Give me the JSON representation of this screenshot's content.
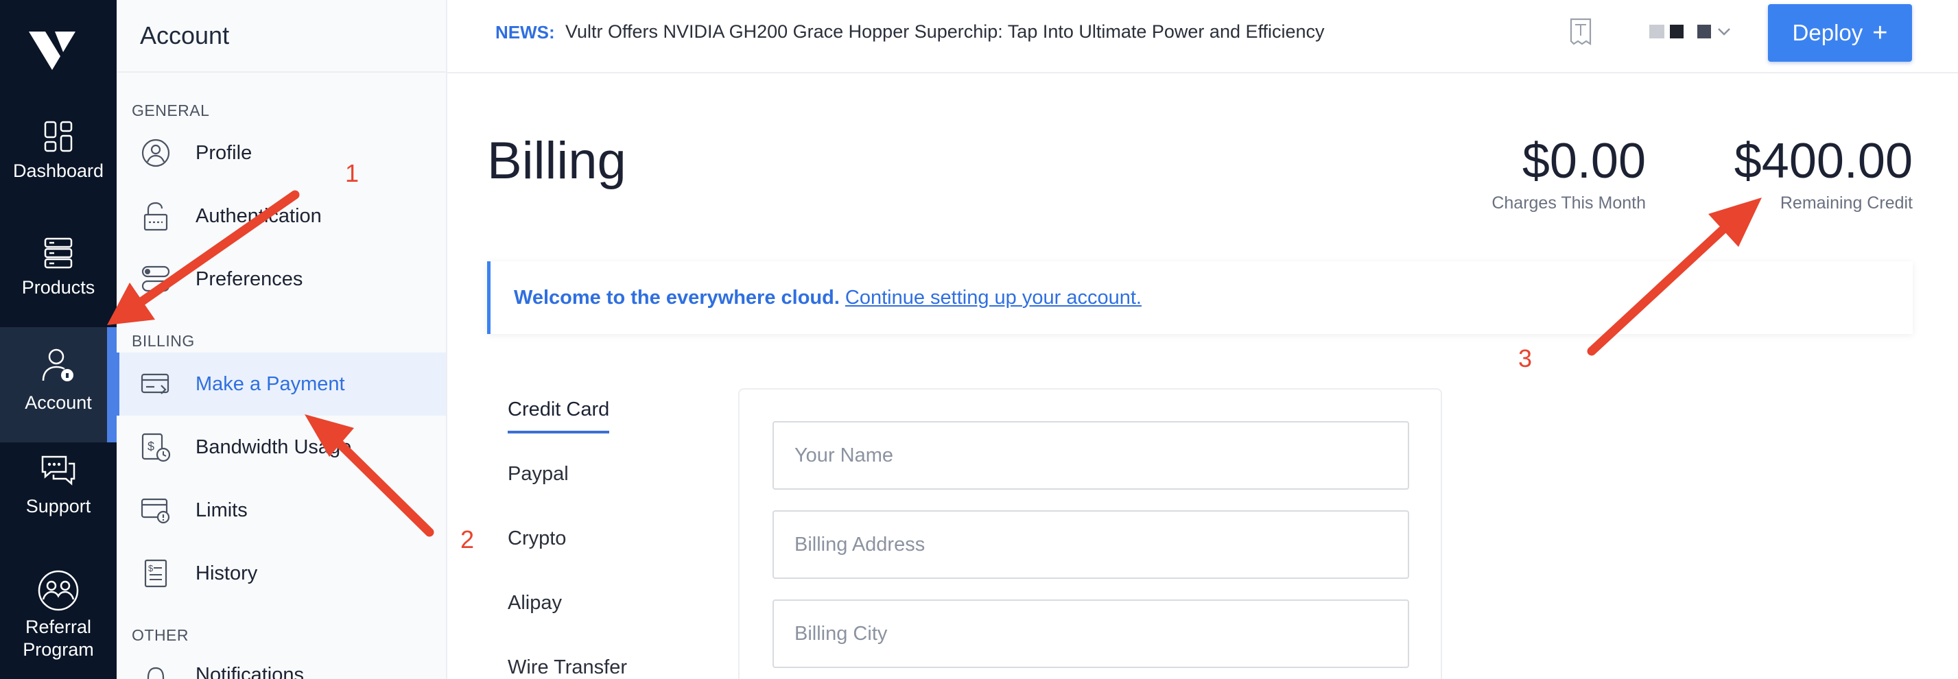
{
  "rail": {
    "items": [
      {
        "label": "Dashboard",
        "icon": "grid-icon"
      },
      {
        "label": "Products",
        "icon": "server-stack-icon"
      },
      {
        "label": "Account",
        "icon": "user-lock-icon"
      },
      {
        "label": "Support",
        "icon": "chat-bubble-icon"
      },
      {
        "label": "Referral Program",
        "icon": "people-group-icon"
      }
    ],
    "active": "Account"
  },
  "submenu": {
    "title": "Account",
    "general_label": "GENERAL",
    "billing_label": "BILLING",
    "other_label": "OTHER",
    "general": [
      {
        "label": "Profile",
        "icon": "user-circle-icon"
      },
      {
        "label": "Authentication",
        "icon": "unlock-icon"
      },
      {
        "label": "Preferences",
        "icon": "toggle-icon"
      }
    ],
    "billing": [
      {
        "label": "Make a Payment",
        "icon": "credit-card-icon"
      },
      {
        "label": "Bandwidth Usage",
        "icon": "usage-dollar-icon"
      },
      {
        "label": "Limits",
        "icon": "card-limit-icon"
      },
      {
        "label": "History",
        "icon": "receipt-icon"
      }
    ],
    "other": [
      {
        "label": "Notifications",
        "icon": "bell-icon"
      }
    ]
  },
  "topbar": {
    "news_tag": "NEWS:",
    "news_text": "Vultr Offers NVIDIA GH200 Grace Hopper Superchip: Tap Into Ultimate Power and Efficiency",
    "deploy_label": "Deploy",
    "deploy_plus": "+"
  },
  "billing": {
    "title": "Billing",
    "charges_value": "$0.00",
    "charges_caption": "Charges This Month",
    "credit_value": "$400.00",
    "credit_caption": "Remaining Credit"
  },
  "welcome": {
    "bold": "Welcome to the everywhere cloud.",
    "link": "Continue setting up your account."
  },
  "payment_methods": [
    "Credit Card",
    "Paypal",
    "Crypto",
    "Alipay",
    "Wire Transfer"
  ],
  "form": {
    "fields": [
      {
        "placeholder": "Your Name"
      },
      {
        "placeholder": "Billing Address"
      },
      {
        "placeholder": "Billing City"
      }
    ]
  },
  "annotations": [
    "1",
    "2",
    "3"
  ],
  "colors": {
    "rail_bg": "#0a1527",
    "accent": "#3b82f1",
    "annotation": "#e8442e"
  }
}
